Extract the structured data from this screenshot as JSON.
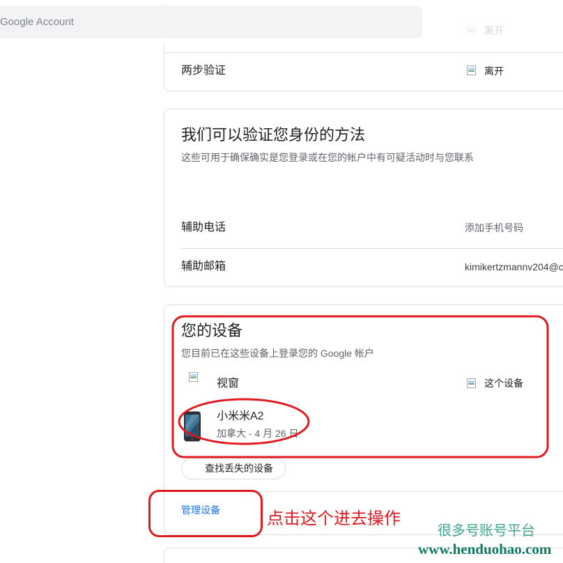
{
  "header": {
    "search_placeholder": "Google Account"
  },
  "two_step_card": {
    "top_status": "离开",
    "label": "两步验证",
    "status": "离开",
    "status_icon": "broken-image-icon"
  },
  "verify_card": {
    "title": "我们可以验证您身份的方法",
    "subtitle": "这些可用于确保确实是您登录或在您的帐户中有可疑活动时与您联系",
    "rows": [
      {
        "label": "辅助电话",
        "value": "添加手机号码"
      },
      {
        "label": "辅助邮箱",
        "value": "kimikertzmannv204@c"
      }
    ]
  },
  "devices_card": {
    "title": "您的设备",
    "subtitle": "您目前已在这些设备上登录您的 Google 帐户",
    "devices": [
      {
        "name": "视窗",
        "status": "这个设备",
        "icon": "broken-image-icon"
      },
      {
        "name": "小米米A2",
        "detail": "加拿大 - 4 月 26 日",
        "icon": "phone-icon"
      }
    ],
    "find_button": "查找丢失的设备",
    "manage_link": "管理设备"
  },
  "annotation": {
    "text": "点击这个进去操作"
  },
  "watermark": {
    "line1": "很多号账号平台",
    "line2": "www.henduohao.com"
  },
  "colors": {
    "text": "#202124",
    "text2": "#5f6368",
    "border": "#dadce0",
    "link": "#1a73e8",
    "red": "#e0191f",
    "wm1": "#3fa48f",
    "wm2": "#0e7a62",
    "search_bg": "#f1f3f4"
  }
}
